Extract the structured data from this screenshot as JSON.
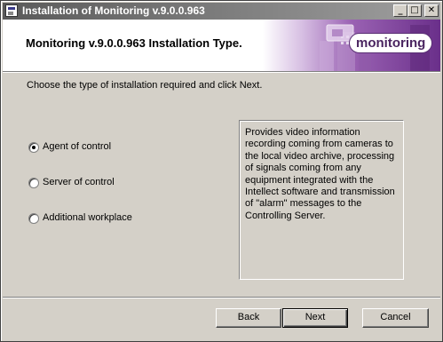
{
  "window": {
    "title": "Installation of Monitoring v.9.0.0.963"
  },
  "titlebar_buttons": {
    "minimize": "_",
    "maximize": "□",
    "close": "✕"
  },
  "header": {
    "title": "Monitoring v.9.0.0.963 Installation Type.",
    "logo": "monitoring"
  },
  "instruction": "Choose the type of installation required and click Next.",
  "options": [
    {
      "label": "Agent of control",
      "selected": true
    },
    {
      "label": "Server of control",
      "selected": false
    },
    {
      "label": "Additional workplace",
      "selected": false
    }
  ],
  "description": "Provides video information recording coming from cameras to the local video archive, processing of signals coming from any equipment integrated with the Intellect software and transmission of \"alarm\" messages to the Controlling Server.",
  "buttons": {
    "back": "Back",
    "next": "Next",
    "cancel": "Cancel"
  },
  "colors": {
    "titlebar_start": "#5a5a5a",
    "titlebar_end": "#9f9f9f",
    "banner_accent": "#7a3f98",
    "dialog_bg": "#d4d0c8"
  }
}
